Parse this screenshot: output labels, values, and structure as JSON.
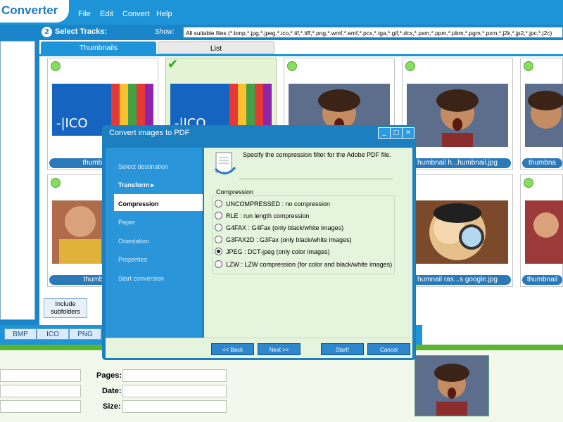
{
  "app": {
    "title": "Converter"
  },
  "menu": [
    "File",
    "Edit",
    "Convert",
    "Help"
  ],
  "tracks": {
    "step": "2",
    "title": "Select Tracks:",
    "show_label": "Show:",
    "show_value": "All suitable files (*.bmp,*.jpg,*.jpeg,*.ico,*.tif,*.tiff,*.png,*.wmf,*.emf,*.pcx,*.tga,*.gif,*.dcx,*.pxm,*.ppm,*.pbm,*.pgm,*.pxm,*.j2k,*.jp2,*.jpc,*.j2c)"
  },
  "tabs": {
    "thumbnails": "Thumbnails",
    "list": "List"
  },
  "thumbnails": [
    {
      "caption": "thumbnail go"
    },
    {
      "caption": ""
    },
    {
      "caption": ""
    },
    {
      "caption": "humbnail h...humbnail.jpg"
    },
    {
      "caption": "thumbna"
    },
    {
      "caption": "thumbnail re"
    },
    {
      "caption": ""
    },
    {
      "caption": ""
    },
    {
      "caption": "humnail ras...s google.jpg"
    },
    {
      "caption": "thumbnail"
    }
  ],
  "include_subfolders": "Include subfolders",
  "formats": [
    "BMP",
    "ICO",
    "PNG"
  ],
  "bottom": {
    "pages_label": "Pages:",
    "date_label": "Date:",
    "size_label": "Size:"
  },
  "dialog": {
    "title": "Convert images to PDF",
    "nav": [
      "Select destination",
      "Transform",
      "Compression",
      "Paper",
      "Orientation",
      "Properties",
      "Start conversion"
    ],
    "intro": "Specify the compression filter for the Adobe PDF file.",
    "group": "Compression",
    "options": [
      "UNCOMPRESSED : no compression",
      "RLE : run length compression",
      "G4FAX : G4Fax (only black/white images)",
      "G3FAX2D : G3Fax (only black/white images)",
      "JPEG : DCT-jpeg (only color images)",
      "LZW : LZW compression (for color and black/white images)"
    ],
    "selected_option": "JPEG : DCT-jpeg (only color images)",
    "buttons": {
      "back": "<< Back",
      "next": "Next >>",
      "start": "Start!",
      "cancel": "Cancel"
    }
  },
  "colors": {
    "brand_blue": "#1e95d8",
    "accent_green": "#58b62f",
    "dialog_bg": "#e5f4dc"
  }
}
